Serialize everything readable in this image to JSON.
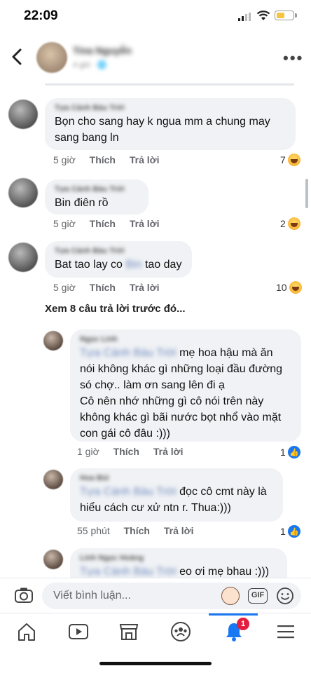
{
  "status": {
    "time": "22:09"
  },
  "header": {
    "name": "Tina Nguyễn",
    "subtitle": "4 giờ · 🌐"
  },
  "comments": [
    {
      "author": "Tựa Cánh Bàu Trời",
      "text": "Bọn cho sang hay k  ngua mm a chung may sang bang ln",
      "time": "5 giờ",
      "like": "Thích",
      "reply": "Trả lời",
      "reactions": "7",
      "reaction_icon": "haha-icon"
    },
    {
      "author": "Tựa Cánh Bàu Trời",
      "text": "Bin điên rồ",
      "time": "5 giờ",
      "like": "Thích",
      "reply": "Trả lời",
      "reactions": "2",
      "reaction_icon": "haha-icon"
    },
    {
      "author": "Tựa Cánh Bàu Trời",
      "text_before": "Bat tao lay co ",
      "text_blur": "Bin",
      "text_after": " tao day",
      "time": "5 giờ",
      "like": "Thích",
      "reply": "Trả lời",
      "reactions": "10",
      "reaction_icon": "haha-icon"
    }
  ],
  "view_previous": "Xem 8 câu trả lời trước đó...",
  "replies": [
    {
      "author": "Ngọc Linh",
      "mention": "Tựa Cánh Bàu Trời",
      "text_first": " mẹ hoa hậu mà ăn",
      "text_rest": "nói không khác gì những loại đầu đường\nsó chợ.. làm ơn sang lên đi ạ\nCô nên nhớ những gì cô nói trên này\nkhông khác gì bãi nước bọt nhổ vào mặt\ncon gái cô đâu :)))",
      "time": "1 giờ",
      "like": "Thích",
      "reply": "Trả lời",
      "reactions": "1",
      "reaction_icon": "like-icon"
    },
    {
      "author": "Hoa Bùi",
      "mention": "Tựa Cánh Bàu Trời",
      "text_first": " đọc cô cmt này là",
      "text_rest": "hiểu cách cư xử ntn r. Thua:)))",
      "time": "55 phút",
      "like": "Thích",
      "reply": "Trả lời",
      "reactions": "1",
      "reaction_icon": "like-icon"
    },
    {
      "author": "Linh Ngọc Hoàng",
      "mention": "Tựa Cánh Bàu Trời",
      "text_first": " eo ơi mẹ bhau :)))"
    }
  ],
  "composer": {
    "placeholder": "Viết bình luận...",
    "gif_label": "GIF"
  },
  "tabbar": {
    "tabs": [
      "home-icon",
      "watch-icon",
      "marketplace-icon",
      "groups-icon",
      "notifications-icon",
      "menu-icon"
    ],
    "notification_badge": "1"
  },
  "colors": {
    "accent": "#1877f2",
    "badge": "#e41e3f",
    "bubble": "#f0f2f5",
    "battery": "#f5c542"
  },
  "battery_level": 0.5
}
